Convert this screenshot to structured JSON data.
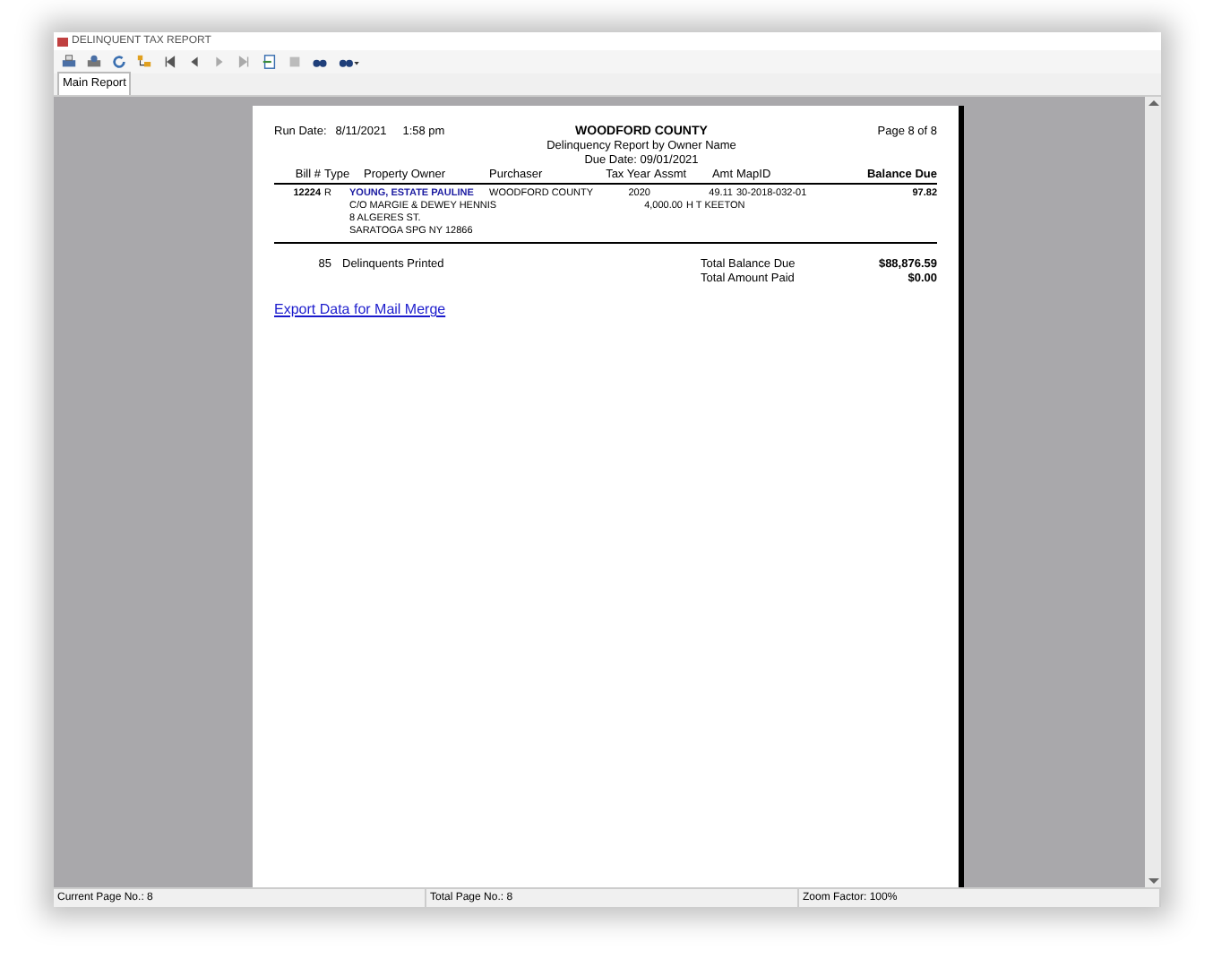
{
  "window": {
    "title": "DELINQUENT TAX REPORT"
  },
  "toolbar": [
    {
      "kind": "print"
    },
    {
      "kind": "setup"
    },
    {
      "kind": "refresh"
    },
    {
      "kind": "tree"
    },
    {
      "kind": "first"
    },
    {
      "kind": "prev"
    },
    {
      "kind": "next"
    },
    {
      "kind": "last"
    },
    {
      "kind": "goto"
    },
    {
      "kind": "stop"
    },
    {
      "kind": "search"
    },
    {
      "kind": "zoom"
    }
  ],
  "tabs": [
    {
      "label": "Main Report",
      "selected": true
    }
  ],
  "report": {
    "run_date_label": "Run Date:",
    "run_date": "8/11/2021",
    "run_time": "1:58 pm",
    "county": "WOODFORD COUNTY",
    "subtitle": "Delinquency Report by Owner Name",
    "due_date": "Due Date: 09/01/2021",
    "page": "Page 8 of 8",
    "columns": [
      "Bill #",
      "Type",
      "Property Owner",
      "Purchaser",
      "Tax Year",
      "Assmt",
      "Amt",
      "MapID",
      "Balance Due"
    ],
    "rows": [
      {
        "bill": "12224",
        "type": "R",
        "owner": "YOUNG, ESTATE PAULINE",
        "address": [
          "C/O MARGIE & DEWEY HENNIS",
          "8 ALGERES ST.",
          "SARATOGA SPG NY 12866"
        ],
        "purchaser": "WOODFORD COUNTY",
        "tax_year": "2020",
        "amt": "49.11",
        "map_id": "30-2018-032-01",
        "assmt": "4,000.00",
        "map_name": "H T KEETON",
        "balance": "97.82"
      }
    ],
    "count": "85",
    "count_label": "Delinquents Printed",
    "totals": [
      {
        "label": "Total Balance Due",
        "value": "$88,876.59"
      },
      {
        "label": "Total Amount Paid",
        "value": "$0.00"
      }
    ],
    "link": "Export Data for Mail Merge"
  },
  "status_bar": [
    "Current Page No.: 8",
    "Total Page No.: 8",
    "Zoom Factor: 100%"
  ]
}
